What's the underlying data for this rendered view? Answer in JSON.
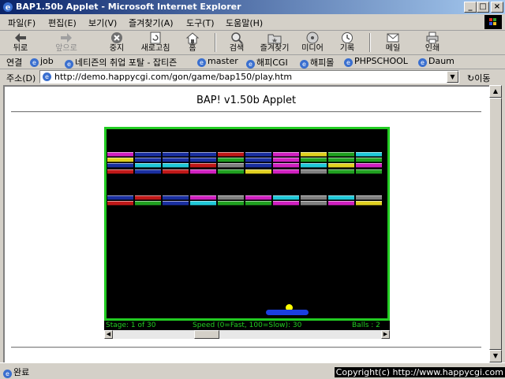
{
  "window": {
    "title": "BAP1.50b Applet - Microsoft Internet Explorer",
    "minimize": "_",
    "maximize": "□",
    "close": "×"
  },
  "menu": [
    "파일(F)",
    "편집(E)",
    "보기(V)",
    "즐겨찾기(A)",
    "도구(T)",
    "도움말(H)"
  ],
  "toolbar": {
    "back": "뒤로",
    "forward": "앞으로",
    "stop": "중지",
    "refresh": "새로고침",
    "home": "홈",
    "search": "검색",
    "favorites": "즐겨찾기",
    "media": "미디어",
    "history": "기록",
    "mail": "메일",
    "print": "인쇄"
  },
  "links": {
    "label": "연결",
    "items": [
      "job",
      "네티즌의 취업 포탈 - 잡티즌",
      "master",
      "해피CGI",
      "해피몰",
      "PHPSCHOOL",
      "Daum"
    ]
  },
  "address": {
    "label": "주소(D)",
    "url": "http://demo.happycgi.com/gon/game/bap150/play.htm",
    "go": "이동"
  },
  "page": {
    "title": "BAP! v1.50b Applet"
  },
  "game": {
    "stage": "Stage: 1 of 30",
    "speed": "Speed (0=Fast, 100=Slow): 30",
    "balls": "Balls : 2",
    "rows": [
      [
        "#d020c0",
        "#1a2fa0",
        "#1a2fa0",
        "#1a2fa0",
        "#c01818",
        "#1a2fa0",
        "#d020c0",
        "#e0d020",
        "#20a020",
        "#20c8d8"
      ],
      [
        "#e0d020",
        "#1a2fa0",
        "#1a2fa0",
        "#1a2fa0",
        "#20a020",
        "#1a2fa0",
        "#d020c0",
        "#20a020",
        "#20a020",
        "#20a020"
      ],
      [
        "#1a2fa0",
        "#20c8d8",
        "#20c8d8",
        "#c01818",
        "#808080",
        "#1a2fa0",
        "#d020c0",
        "#20c8d8",
        "#e0d020",
        "#d020c0"
      ],
      [
        "#c01818",
        "#1a2fa0",
        "#c01818",
        "#d020c0",
        "#20a020",
        "#e0d020",
        "#d020c0",
        "#808080",
        "#20a020",
        "#20a020"
      ],
      [
        "#1a2fa0",
        "#c01818",
        "#1a2fa0",
        "#d020c0",
        "#808080",
        "#d020c0",
        "#20c8d8",
        "#808080",
        "#20c8d8",
        "#808080"
      ],
      [
        "#c01818",
        "#20a020",
        "#1a2fa0",
        "#20c8d8",
        "#20a020",
        "#20a020",
        "#d020c0",
        "#808080",
        "#d020c0",
        "#e0d020"
      ]
    ]
  },
  "status": {
    "text": "완료",
    "copyright": "Copyright(c) http://www.happycgi.com"
  }
}
